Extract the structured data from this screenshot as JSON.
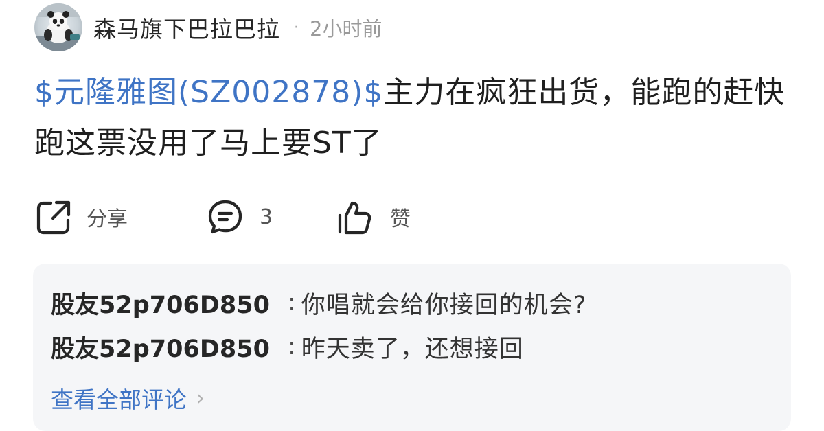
{
  "post": {
    "author": "森马旗下巴拉巴拉",
    "dot": "·",
    "time": "2小时前",
    "stock_tag": "$元隆雅图(SZ002878)$",
    "text": "主力在疯狂出货，能跑的赶快跑这票没用了马上要ST了"
  },
  "actions": {
    "share_label": "分享",
    "comment_count": "3",
    "like_label": "赞"
  },
  "comments": [
    {
      "user": "股友52p706D850",
      "sep": ":",
      "text": "你唱就会给你接回的机会?"
    },
    {
      "user": "股友52p706D850",
      "sep": ":",
      "text": "昨天卖了，还想接回"
    }
  ],
  "view_all": {
    "label": "查看全部评论",
    "chevron": "›"
  },
  "colors": {
    "link": "#3f74c5",
    "panel": "#f5f6f8",
    "muted": "#9a9a9a"
  },
  "icons": {
    "share": "share-icon",
    "comment": "comment-bubble-icon",
    "like": "thumbs-up-icon"
  }
}
